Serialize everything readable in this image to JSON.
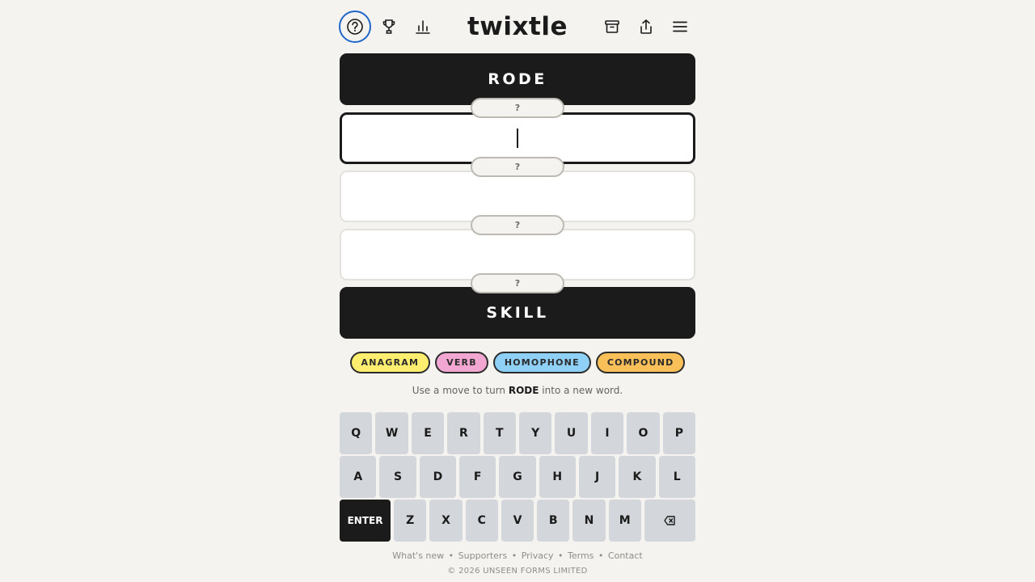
{
  "header": {
    "logo": "twixtle",
    "icons": [
      "help-icon",
      "trophy-icon",
      "stats-icon",
      "archive-icon",
      "share-icon",
      "menu-icon"
    ]
  },
  "game": {
    "start_word": "RODE",
    "end_word": "SKILL",
    "connector_label": "?"
  },
  "tags": [
    {
      "label": "ANAGRAM",
      "color": "#fdee6f"
    },
    {
      "label": "VERB",
      "color": "#f2a7d3"
    },
    {
      "label": "HOMOPHONE",
      "color": "#8fd0f6"
    },
    {
      "label": "COMPOUND",
      "color": "#f9bf58"
    }
  ],
  "hint": {
    "prefix": "Use a move to turn",
    "word": "RODE",
    "suffix": "into a new word."
  },
  "keyboard": {
    "row1": [
      "Q",
      "W",
      "E",
      "R",
      "T",
      "Y",
      "U",
      "I",
      "O",
      "P"
    ],
    "row2": [
      "A",
      "S",
      "D",
      "F",
      "G",
      "H",
      "J",
      "K",
      "L"
    ],
    "row3": [
      "Z",
      "X",
      "C",
      "V",
      "B",
      "N",
      "M"
    ],
    "enter_label": "ENTER",
    "backspace_icon": "backspace-icon"
  },
  "footer": {
    "links": [
      "What's new",
      "Supporters",
      "Privacy",
      "Terms",
      "Contact"
    ],
    "separator": "•",
    "copyright": "© 2026 UNSEEN FORMS LIMITED"
  }
}
